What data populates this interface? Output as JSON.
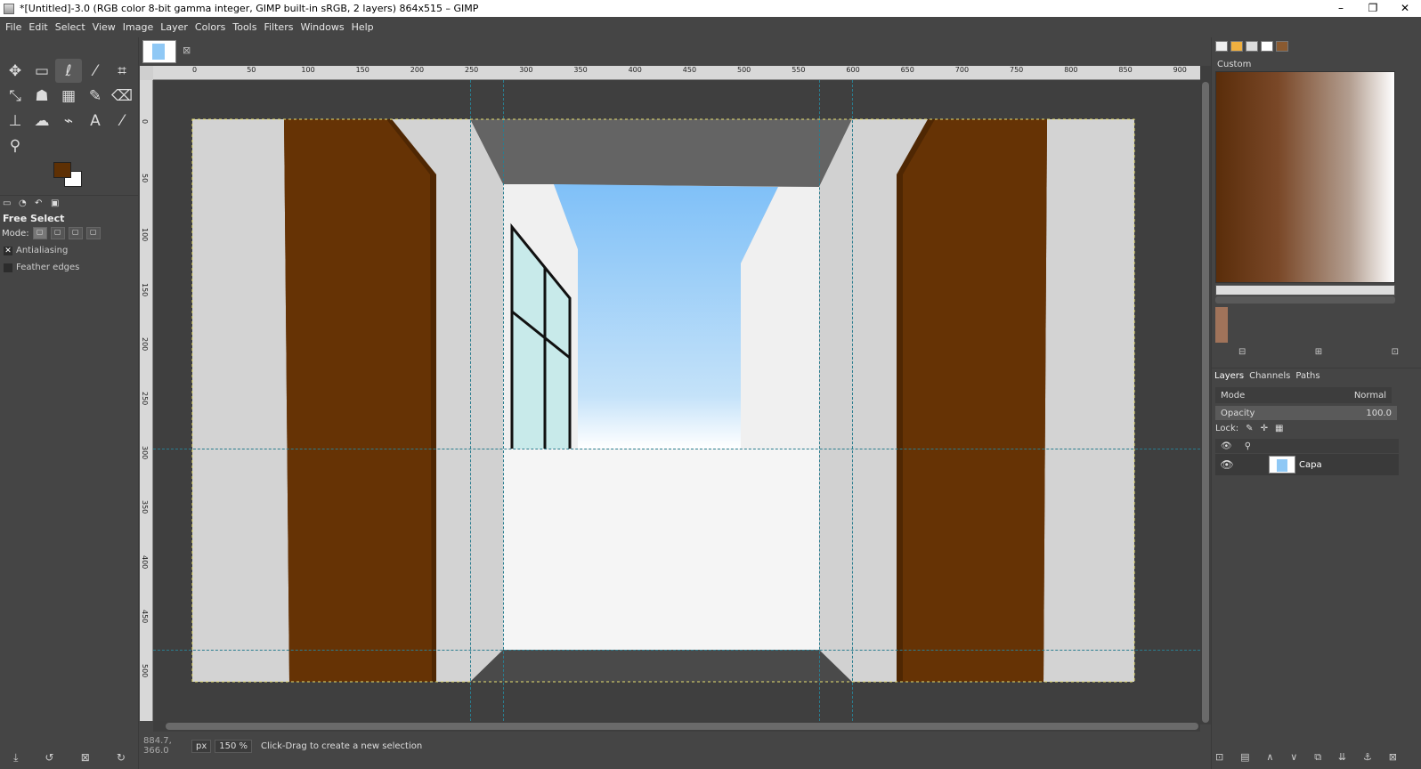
{
  "window": {
    "title": "*[Untitled]-3.0 (RGB color 8-bit gamma integer, GIMP built-in sRGB, 2 layers) 864x515 – GIMP",
    "minimize": "–",
    "maximize": "❐",
    "close": "✕"
  },
  "menu": [
    "File",
    "Edit",
    "Select",
    "View",
    "Image",
    "Layer",
    "Colors",
    "Tools",
    "Filters",
    "Windows",
    "Help"
  ],
  "tools": {
    "row1": [
      "move-tool-icon",
      "rect-select-icon",
      "free-select-icon",
      "fuzzy-select-icon",
      "crop-icon"
    ],
    "row2": [
      "transform-icon",
      "warp-icon",
      "gradient-icon",
      "paintbrush-icon",
      "eraser-icon"
    ],
    "row3": [
      "clone-icon",
      "smudge-icon",
      "paths-icon",
      "text-icon",
      "color-picker-icon"
    ],
    "row4": [
      "zoom-icon"
    ],
    "fg_color": "#5e3004",
    "bg_color": "#ffffff"
  },
  "tool_options": {
    "title": "Free Select",
    "mode_label": "Mode:",
    "antialiasing": "Antialiasing",
    "feather": "Feather edges"
  },
  "status": {
    "coords": "884.7, 366.0",
    "unit": "px",
    "zoom": "150 %",
    "message": "Click-Drag to create a new selection"
  },
  "ruler": {
    "h_labels": [
      "0",
      "50",
      "100",
      "150",
      "200",
      "250",
      "300",
      "350",
      "400",
      "450",
      "500",
      "550",
      "600",
      "650",
      "700",
      "750",
      "800",
      "850",
      "900"
    ],
    "v_labels": [
      "0",
      "50",
      "100",
      "150",
      "200",
      "250",
      "300",
      "350",
      "400",
      "450",
      "500"
    ]
  },
  "gradient": {
    "label": "Custom"
  },
  "layers": {
    "tabs": [
      "Layers",
      "Channels",
      "Paths"
    ],
    "mode_label": "Mode",
    "mode_value": "Normal",
    "opacity_label": "Opacity",
    "opacity_value": "100.0",
    "lock_label": "Lock:",
    "layer_name": "Capa"
  }
}
